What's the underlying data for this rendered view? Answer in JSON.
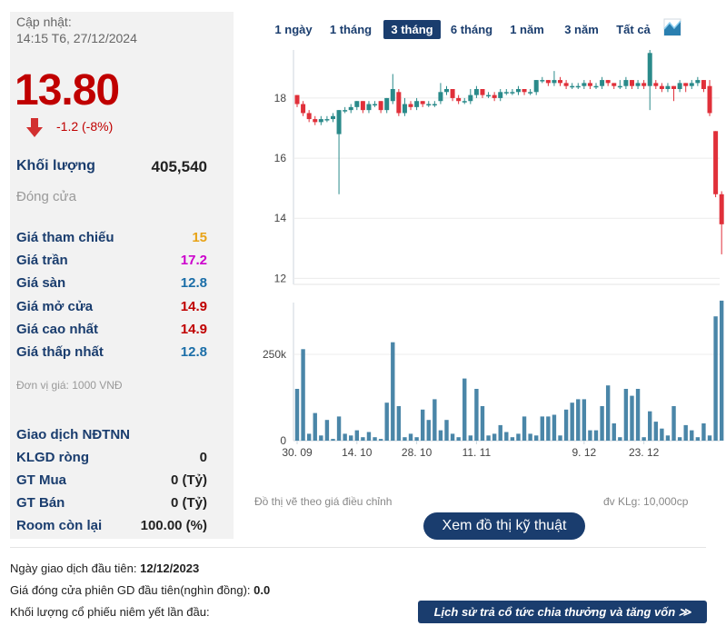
{
  "summary": {
    "updated_label": "Cập nhật:",
    "updated_time": "14:15 T6, 27/12/2024",
    "price": "13.80",
    "change": "-1.2 (-8%)",
    "volume_label": "Khối lượng",
    "volume_value": "405,540",
    "close_label": "Đóng cửa"
  },
  "prices": [
    {
      "label": "Giá tham chiếu",
      "value": "15",
      "color": "#e8a317"
    },
    {
      "label": "Giá trần",
      "value": "17.2",
      "color": "#cc00cc"
    },
    {
      "label": "Giá sàn",
      "value": "12.8",
      "color": "#1b6ea8"
    },
    {
      "label": "Giá mở cửa",
      "value": "14.9",
      "color": "#c00000"
    },
    {
      "label": "Giá cao nhất",
      "value": "14.9",
      "color": "#c00000"
    },
    {
      "label": "Giá thấp nhất",
      "value": "12.8",
      "color": "#1b6ea8"
    }
  ],
  "unit_note": "Đơn vị giá: 1000 VNĐ",
  "foreign": {
    "title": "Giao dịch NĐTNN",
    "rows": [
      {
        "label": "KLGD ròng",
        "value": "0"
      },
      {
        "label": "GT Mua",
        "value": "0 (Tỷ)"
      },
      {
        "label": "GT Bán",
        "value": "0 (Tỷ)"
      },
      {
        "label": "Room còn lại",
        "value": "100.00 (%)"
      }
    ]
  },
  "range_tabs": [
    "1 ngày",
    "1 tháng",
    "3 tháng",
    "6 tháng",
    "1 năm",
    "3 năm",
    "Tất cả"
  ],
  "active_tab": "3 tháng",
  "chart_data": {
    "type": "candlestick",
    "y_ticks": [
      "18",
      "16",
      "14",
      "12"
    ],
    "ylim": [
      11.8,
      19.6
    ],
    "volume_ticks": [
      "250k",
      "0"
    ],
    "volume_ylim": [
      0,
      400000
    ],
    "x_ticks": [
      "30. 09",
      "14. 10",
      "28. 10",
      "11. 11",
      "9. 12",
      "23. 12"
    ],
    "up_color": "#2a8a8a",
    "down_color": "#e0303a",
    "volume_color": "#4a86a8",
    "candles": [
      [
        18.1,
        17.8,
        18.1,
        17.7
      ],
      [
        17.8,
        17.5,
        17.9,
        17.4
      ],
      [
        17.5,
        17.3,
        17.6,
        17.2
      ],
      [
        17.3,
        17.2,
        17.4,
        17.1
      ],
      [
        17.2,
        17.3,
        17.4,
        17.1
      ],
      [
        17.3,
        17.3,
        17.4,
        17.2
      ],
      [
        17.3,
        17.4,
        17.5,
        17.2
      ],
      [
        16.8,
        17.6,
        17.6,
        14.8
      ],
      [
        17.6,
        17.6,
        17.7,
        17.5
      ],
      [
        17.6,
        17.7,
        17.8,
        17.5
      ],
      [
        17.7,
        17.9,
        17.9,
        17.6
      ],
      [
        17.9,
        17.6,
        17.9,
        17.5
      ],
      [
        17.6,
        17.8,
        17.9,
        17.5
      ],
      [
        17.8,
        17.8,
        17.9,
        17.7
      ],
      [
        17.9,
        17.6,
        17.9,
        17.5
      ],
      [
        17.6,
        18.0,
        18.0,
        17.5
      ],
      [
        17.9,
        18.3,
        18.8,
        17.8
      ],
      [
        18.2,
        17.5,
        18.3,
        17.4
      ],
      [
        17.5,
        17.8,
        18.0,
        17.4
      ],
      [
        17.8,
        17.7,
        17.9,
        17.6
      ],
      [
        17.7,
        17.9,
        18.0,
        17.6
      ],
      [
        17.9,
        17.8,
        17.9,
        17.7
      ],
      [
        17.8,
        17.8,
        17.9,
        17.7
      ],
      [
        17.8,
        17.8,
        17.9,
        17.7
      ],
      [
        17.9,
        18.2,
        18.5,
        17.8
      ],
      [
        18.2,
        18.3,
        18.4,
        18.1
      ],
      [
        18.3,
        18.0,
        18.3,
        17.9
      ],
      [
        18.0,
        17.9,
        18.1,
        17.8
      ],
      [
        17.9,
        17.9,
        18.0,
        17.8
      ],
      [
        17.9,
        18.1,
        18.3,
        17.8
      ],
      [
        18.1,
        18.3,
        18.4,
        18.0
      ],
      [
        18.3,
        18.1,
        18.3,
        18.0
      ],
      [
        18.1,
        18.1,
        18.2,
        18.0
      ],
      [
        18.1,
        18.0,
        18.2,
        17.9
      ],
      [
        18.0,
        18.2,
        18.3,
        17.9
      ],
      [
        18.2,
        18.2,
        18.3,
        18.1
      ],
      [
        18.2,
        18.2,
        18.3,
        18.1
      ],
      [
        18.2,
        18.3,
        18.4,
        18.1
      ],
      [
        18.3,
        18.2,
        18.3,
        18.1
      ],
      [
        18.2,
        18.2,
        18.3,
        18.1
      ],
      [
        18.2,
        18.6,
        18.6,
        18.1
      ],
      [
        18.6,
        18.6,
        18.7,
        18.5
      ],
      [
        18.6,
        18.5,
        18.6,
        18.4
      ],
      [
        18.5,
        18.6,
        18.9,
        18.4
      ],
      [
        18.6,
        18.5,
        18.7,
        18.4
      ],
      [
        18.5,
        18.4,
        18.6,
        18.3
      ],
      [
        18.4,
        18.4,
        18.5,
        18.3
      ],
      [
        18.4,
        18.4,
        18.5,
        18.3
      ],
      [
        18.4,
        18.5,
        18.6,
        18.3
      ],
      [
        18.5,
        18.4,
        18.6,
        18.3
      ],
      [
        18.4,
        18.4,
        18.5,
        18.3
      ],
      [
        18.4,
        18.6,
        18.7,
        18.3
      ],
      [
        18.6,
        18.5,
        18.6,
        18.4
      ],
      [
        18.5,
        18.4,
        18.5,
        18.3
      ],
      [
        18.4,
        18.4,
        18.6,
        18.3
      ],
      [
        18.4,
        18.6,
        18.7,
        18.3
      ],
      [
        18.6,
        18.4,
        18.6,
        18.3
      ],
      [
        18.4,
        18.5,
        18.6,
        18.3
      ],
      [
        18.5,
        18.4,
        18.6,
        18.3
      ],
      [
        18.4,
        19.5,
        19.6,
        17.6
      ],
      [
        18.5,
        18.4,
        18.6,
        18.3
      ],
      [
        18.4,
        18.3,
        18.5,
        18.2
      ],
      [
        18.3,
        18.4,
        18.5,
        18.2
      ],
      [
        18.4,
        18.3,
        18.4,
        17.9
      ],
      [
        18.3,
        18.5,
        18.6,
        18.2
      ],
      [
        18.5,
        18.4,
        18.5,
        18.2
      ],
      [
        18.4,
        18.5,
        18.6,
        18.3
      ],
      [
        18.5,
        18.6,
        18.7,
        18.4
      ],
      [
        18.6,
        18.3,
        18.6,
        18.2
      ],
      [
        18.4,
        17.5,
        18.6,
        17.4
      ],
      [
        16.9,
        14.8,
        16.9,
        14.7
      ],
      [
        14.8,
        13.8,
        14.9,
        12.8
      ]
    ],
    "volumes": [
      150000,
      265000,
      20000,
      80000,
      15000,
      60000,
      5000,
      70000,
      20000,
      15000,
      30000,
      10000,
      25000,
      10000,
      5000,
      110000,
      285000,
      100000,
      10000,
      20000,
      10000,
      90000,
      60000,
      120000,
      30000,
      60000,
      20000,
      10000,
      180000,
      15000,
      150000,
      100000,
      15000,
      20000,
      45000,
      25000,
      10000,
      20000,
      70000,
      20000,
      15000,
      70000,
      70000,
      75000,
      15000,
      90000,
      110000,
      120000,
      120000,
      30000,
      30000,
      100000,
      160000,
      50000,
      10000,
      150000,
      130000,
      150000,
      10000,
      85000,
      55000,
      35000,
      15000,
      100000,
      10000,
      45000,
      30000,
      10000,
      50000,
      15000,
      360000,
      405540
    ]
  },
  "chart_note_left": "Đồ thị vẽ theo giá điều chỉnh",
  "chart_note_right": "đv KLg: 10,000cp",
  "tech_button": "Xem đồ thị kỹ thuật",
  "info": {
    "first_trade_label": "Ngày giao dịch đầu tiên:",
    "first_trade_value": "12/12/2023",
    "first_close_label": "Giá đóng cửa phiên GD đầu tiên(nghìn đồng):",
    "first_close_value": "0.0",
    "listed_vol_label": "Khối lượng cổ phiếu niêm yết lần đầu:"
  },
  "history_button": "Lịch sử trả cổ tức chia thưởng và tăng vốn ≫"
}
